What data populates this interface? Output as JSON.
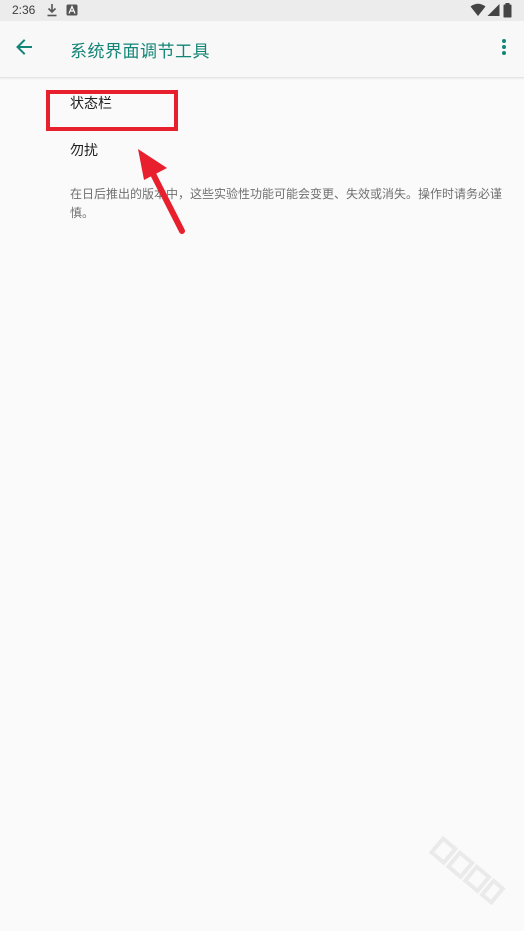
{
  "status_bar": {
    "time": "2:36",
    "icons": [
      "download-icon",
      "a-notification-icon",
      "wifi-icon",
      "signal-icon",
      "battery-icon"
    ]
  },
  "app_bar": {
    "title": "系统界面调节工具",
    "back_icon": "arrow-back-icon",
    "menu_icon": "more-vert-icon"
  },
  "list": {
    "items": [
      {
        "label": "状态栏"
      },
      {
        "label": "勿扰"
      }
    ]
  },
  "footer": {
    "note": "在日后推出的版本中，这些实验性功能可能会变更、失效或消失。操作时请务必谨慎。"
  },
  "colors": {
    "accent": "#138577",
    "annotation_red": "#e8202d",
    "background": "#fafafa",
    "status_bar": "#ececec"
  }
}
